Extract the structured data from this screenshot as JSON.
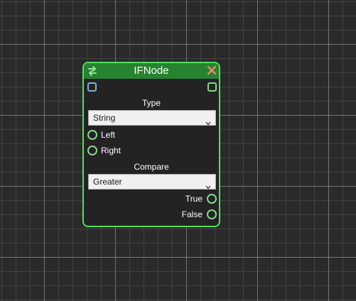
{
  "node": {
    "title": "IFNode",
    "header_icon": "swap-arrows-icon",
    "close_icon": "close-icon",
    "type_label": "Type",
    "type_value": "String",
    "inputs": [
      "Left",
      "Right"
    ],
    "compare_label": "Compare",
    "compare_value": "Greater",
    "outputs": [
      "True",
      "False"
    ]
  },
  "colors": {
    "node_border": "#52e05a",
    "header_bg": "#27832f",
    "body_bg": "#232323",
    "port_green": "#86d98b",
    "port_blue": "#7fb0d8",
    "close_orange": "#e88a6e",
    "canvas_bg": "#2a2a2a"
  }
}
